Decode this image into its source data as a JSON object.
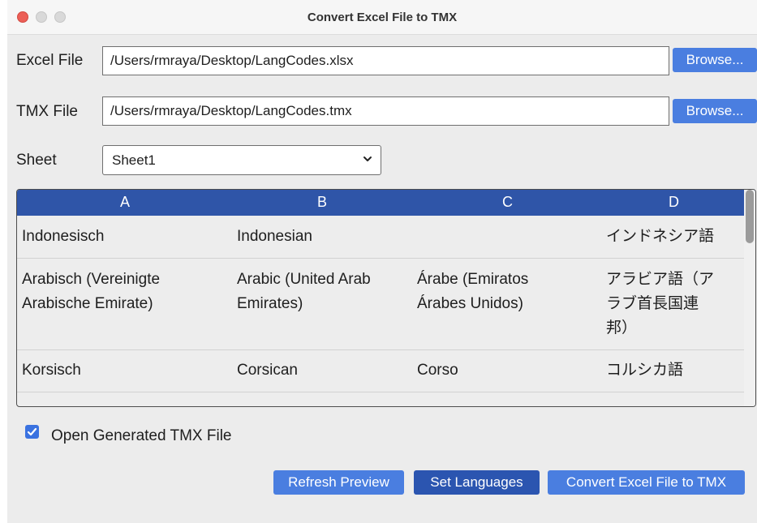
{
  "window": {
    "title": "Convert Excel File to TMX"
  },
  "excel": {
    "label": "Excel File",
    "value": "/Users/rmraya/Desktop/LangCodes.xlsx",
    "browse": "Browse..."
  },
  "tmx": {
    "label": "TMX File",
    "value": "/Users/rmraya/Desktop/LangCodes.tmx",
    "browse": "Browse..."
  },
  "sheet": {
    "label": "Sheet",
    "selected": "Sheet1"
  },
  "grid": {
    "columns": [
      "A",
      "B",
      "C",
      "D"
    ],
    "rows": [
      [
        "Indonesisch",
        "Indonesian",
        "",
        "インドネシア語"
      ],
      [
        "Arabisch (Vereinigte\nArabische Emirate)",
        "Arabic (United Arab\nEmirates)",
        "Árabe (Emiratos\nÁrabes Unidos)",
        "アラビア語（ア\nラブ首長国連\n邦）"
      ],
      [
        "Korsisch",
        "Corsican",
        "Corso",
        "コルシカ語"
      ]
    ]
  },
  "options": {
    "open_generated": "Open Generated TMX File",
    "open_generated_checked": true
  },
  "buttons": {
    "refresh": "Refresh Preview",
    "languages": "Set Languages",
    "convert": "Convert Excel File to TMX"
  },
  "colors": {
    "accent": "#4a7ee0",
    "header": "#2f55a8",
    "close": "#ec5f57"
  }
}
